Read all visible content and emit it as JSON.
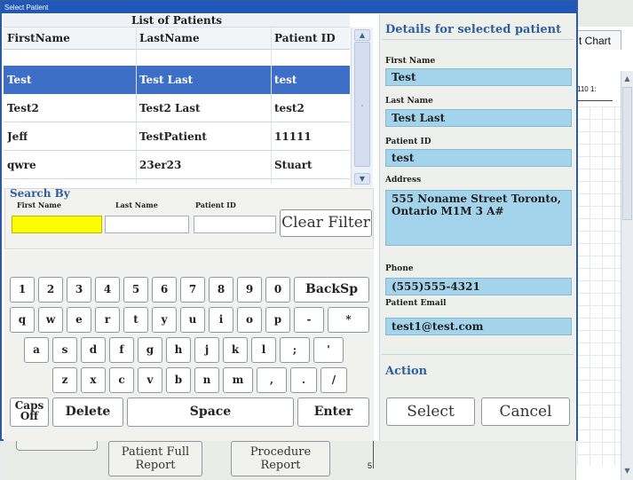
{
  "window": {
    "title": "Select Patient"
  },
  "background": {
    "chart_tab": "t Chart",
    "ruler_label": "110  1:",
    "lower_buttons": {
      "full_report": "Patient Full Report",
      "procedure_report": "Procedure Report"
    },
    "axis_5": "5"
  },
  "patient_list": {
    "title": "List of Patients",
    "columns": [
      "FirstName",
      "LastName",
      "Patient ID"
    ],
    "rows": [
      {
        "first": "Test",
        "last": "Test Last",
        "id": "test",
        "selected": true
      },
      {
        "first": "Test2",
        "last": "Test2 Last",
        "id": "test2",
        "selected": false
      },
      {
        "first": "Jeff",
        "last": "TestPatient",
        "id": "11111",
        "selected": false
      },
      {
        "first": "qwre",
        "last": "23er23",
        "id": "Stuart",
        "selected": false
      }
    ]
  },
  "search": {
    "legend": "Search By",
    "first_name_label": "First Name",
    "last_name_label": "Last Name",
    "patient_id_label": "Patient ID",
    "first_name_value": "",
    "last_name_value": "",
    "patient_id_value": "",
    "clear_filter": "Clear Filter"
  },
  "keyboard": {
    "row1": [
      "1",
      "2",
      "3",
      "4",
      "5",
      "6",
      "7",
      "8",
      "9",
      "0",
      "BackSp"
    ],
    "row2": [
      "q",
      "w",
      "e",
      "r",
      "t",
      "y",
      "u",
      "i",
      "o",
      "p",
      "-",
      "*"
    ],
    "row3": [
      "a",
      "s",
      "d",
      "f",
      "g",
      "h",
      "j",
      "k",
      "l",
      ";",
      "'"
    ],
    "row4": [
      "z",
      "x",
      "c",
      "v",
      "b",
      "n",
      "m",
      ",",
      ".",
      "/"
    ],
    "caps": "Caps Off",
    "delete": "Delete",
    "space": "Space",
    "enter": "Enter"
  },
  "details": {
    "title": "Details for selected patient",
    "first_name_label": "First Name",
    "first_name": "Test",
    "last_name_label": "Last Name",
    "last_name": "Test Last",
    "patient_id_label": "Patient ID",
    "patient_id": "test",
    "address_label": "Address",
    "address": "555 Noname Street Toronto, Ontario  M1M 3 A#",
    "phone_label": "Phone",
    "phone": "(555)555-4321",
    "email_label": "Patient Email",
    "email": "test1@test.com"
  },
  "action": {
    "title": "Action",
    "select": "Select",
    "cancel": "Cancel"
  },
  "colors": {
    "titlebar": "#1f58b8",
    "selected_row": "#3e6fc6",
    "detail_field": "#a4d3ec",
    "search_active": "#fdfd00",
    "section_title": "#2f5ea0"
  }
}
